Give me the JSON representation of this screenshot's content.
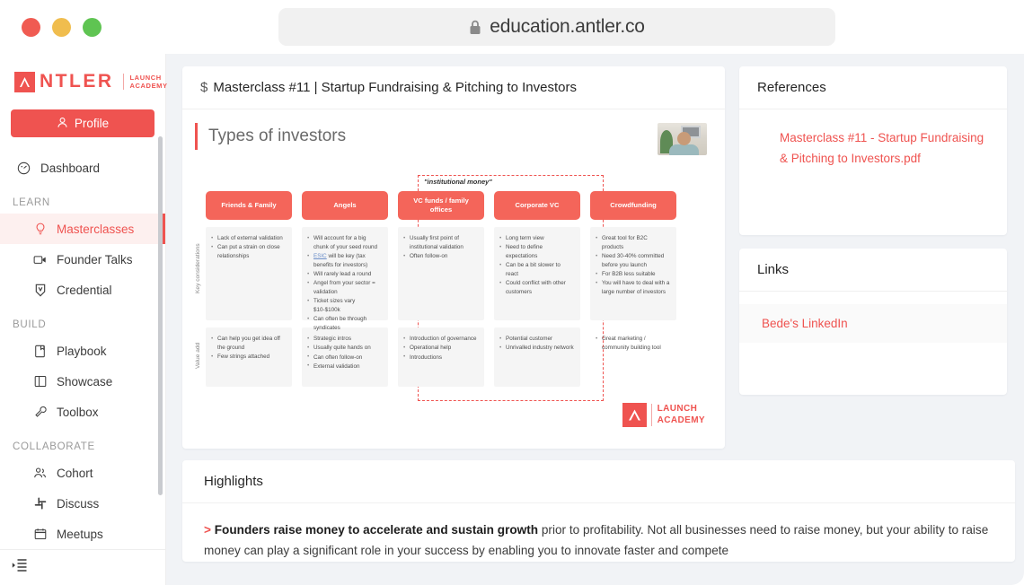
{
  "browser": {
    "url": "education.antler.co",
    "lock_icon": "lock-icon",
    "traffic_lights": [
      "close",
      "minimize",
      "maximize"
    ]
  },
  "sidebar": {
    "logo": {
      "mark": "A",
      "word": "NTLER",
      "sub_line1": "LAUNCH",
      "sub_line2": "ACADEMY"
    },
    "profile_label": "Profile",
    "profile_icon": "user-icon",
    "collapse_icon": "collapse-sidebar-icon",
    "items": [
      {
        "label": "Dashboard",
        "icon": "dashboard-icon",
        "type": "item",
        "active": false
      },
      {
        "label": "LEARN",
        "type": "section"
      },
      {
        "label": "Masterclasses",
        "icon": "lightbulb-icon",
        "type": "item",
        "active": true
      },
      {
        "label": "Founder Talks",
        "icon": "video-icon",
        "type": "item",
        "active": false
      },
      {
        "label": "Credential",
        "icon": "badge-icon",
        "type": "item",
        "active": false
      },
      {
        "label": "BUILD",
        "type": "section"
      },
      {
        "label": "Playbook",
        "icon": "book-icon",
        "type": "item",
        "active": false
      },
      {
        "label": "Showcase",
        "icon": "layout-icon",
        "type": "item",
        "active": false
      },
      {
        "label": "Toolbox",
        "icon": "wrench-icon",
        "type": "item",
        "active": false
      },
      {
        "label": "COLLABORATE",
        "type": "section"
      },
      {
        "label": "Cohort",
        "icon": "people-icon",
        "type": "item",
        "active": false
      },
      {
        "label": "Discuss",
        "icon": "slack-icon",
        "type": "item",
        "active": false
      },
      {
        "label": "Meetups",
        "icon": "calendar-icon",
        "type": "item",
        "active": false
      }
    ]
  },
  "lesson": {
    "title": "Masterclass #11 | Startup Fundraising & Pitching to Investors",
    "title_prefix_icon": "dollar-icon"
  },
  "slide": {
    "heading": "Types of investors",
    "presenter_thumbnail": "webcam-thumbnail",
    "institutional_label": "\"institutional money\"",
    "row_labels": [
      "Key considerations",
      "Value add"
    ],
    "logo": {
      "mark": "A",
      "line1": "LAUNCH",
      "line2": "ACADEMY"
    },
    "columns": [
      {
        "header": "Friends & Family",
        "institutional": false,
        "key_considerations": [
          "Lack of external validation",
          "Can put a strain on close relationships"
        ],
        "value_add": [
          "Can help you get idea off the ground",
          "Few strings attached"
        ]
      },
      {
        "header": "Angels",
        "institutional": false,
        "key_considerations": [
          "Will account for a big chunk of your seed round",
          "ESIC will be key (tax benefits for investors)",
          "Will rarely lead a round",
          "Angel from your sector = validation",
          "Ticket sizes vary $10-$100k",
          "Can often be through syndicates"
        ],
        "value_add": [
          "Strategic intros",
          "Usually quite hands on",
          "Can often follow-on",
          "External validation"
        ]
      },
      {
        "header": "VC  funds / family offices",
        "institutional": true,
        "key_considerations": [
          "Usually first point of institutional validation",
          "Often follow-on"
        ],
        "value_add": [
          "Introduction of governance",
          "Operational help",
          "Introductions"
        ]
      },
      {
        "header": "Corporate VC",
        "institutional": true,
        "key_considerations": [
          "Long term view",
          "Need to define expectations",
          "Can be a bit slower to react",
          "Could conflict with other customers"
        ],
        "value_add": [
          "Potential customer",
          "Unrivalled industry network"
        ]
      },
      {
        "header": "Crowdfunding",
        "institutional": false,
        "key_considerations": [
          "Great tool for B2C products",
          "Need 30-40% committed before you launch",
          "For B2B less suitable",
          "You will have to deal with a large number of investors"
        ],
        "value_add": [
          "Great marketing / community building tool"
        ]
      }
    ]
  },
  "references": {
    "title": "References",
    "items": [
      "Masterclass #11 - Startup Fundraising & Pitching to Investors.pdf"
    ]
  },
  "links": {
    "title": "Links",
    "items": [
      "Bede's LinkedIn"
    ]
  },
  "highlights": {
    "title": "Highlights",
    "marker": ">",
    "bold_text": "Founders raise money to accelerate and sustain growth",
    "rest_text": " prior to profitability. Not all businesses need to raise money, but your ability to raise money can play a significant role in your success by enabling you to innovate faster and compete"
  },
  "colors": {
    "brand_red": "#ef5350",
    "slide_red": "#f4655a",
    "page_bg": "#f1f3f6",
    "active_nav_bg": "#fdf0ef"
  }
}
